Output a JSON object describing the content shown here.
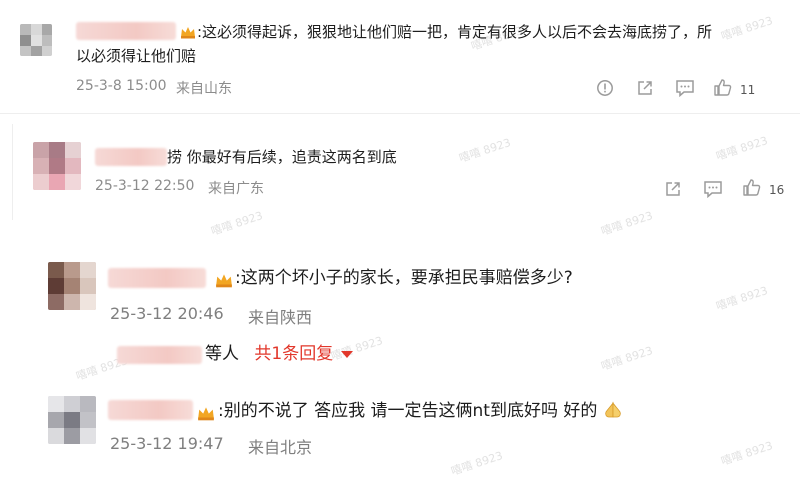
{
  "comments": [
    {
      "text_line1": ":这必须得起诉，狠狠地让他们赔一把，肯定有很多人以后不会去海底捞了，所",
      "text_line2": "以必须得让他们赔",
      "date": "25-3-8 15:00",
      "location": "来自山东",
      "like_count": "11"
    },
    {
      "name_tail": "捞",
      "text": " 你最好有后续，追责这两名到底",
      "date": "25-3-12 22:50",
      "location": "来自广东",
      "like_count": "16"
    },
    {
      "text": ":这两个坏小子的家长，要承担民事赔偿多少?",
      "date": "25-3-12 20:46",
      "location": "来自陕西"
    },
    {
      "text": ":别的不说了 答应我 请一定告这俩nt到底好吗 好的",
      "date": "25-3-12 19:47",
      "location": "来自北京"
    }
  ],
  "reply_summary": {
    "prefix": "等人",
    "link": "共1条回复"
  },
  "watermark_text": "嘻嘻 8923",
  "icons": [
    "report-icon",
    "share-icon",
    "comment-icon",
    "like-icon",
    "crown-icon",
    "pray-emoji-icon"
  ]
}
